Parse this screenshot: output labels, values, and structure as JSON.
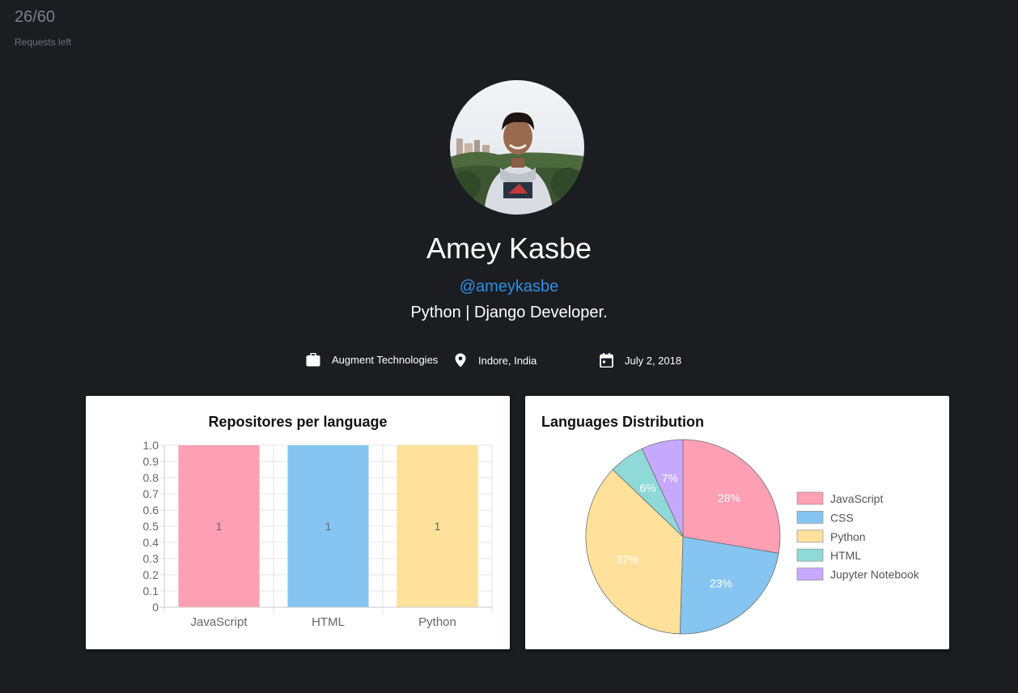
{
  "rate_limit": {
    "count": "26/60",
    "label": "Requests left"
  },
  "profile": {
    "name": "Amey Kasbe",
    "handle": "@ameykasbe",
    "bio": "Python | Django Developer.",
    "company": "Augment Technologies",
    "location": "Indore, India",
    "joined": "July 2, 2018"
  },
  "colors": {
    "background": "#1b1d21",
    "link": "#2e8fe6"
  },
  "chart_data": [
    {
      "type": "bar",
      "title": "Repositores per language",
      "categories": [
        "JavaScript",
        "HTML",
        "Python"
      ],
      "values": [
        1,
        1,
        1
      ],
      "data_labels": [
        "1",
        "1",
        "1"
      ],
      "colors": [
        "#ff9fb3",
        "#86c5f1",
        "#ffe19b"
      ],
      "ylim": [
        0,
        1.0
      ],
      "yticks": [
        "0",
        "0.1",
        "0.2",
        "0.3",
        "0.4",
        "0.5",
        "0.6",
        "0.7",
        "0.8",
        "0.9",
        "1.0"
      ],
      "grid": true
    },
    {
      "type": "pie",
      "title": "Languages Distribution",
      "labels": [
        "JavaScript",
        "CSS",
        "Python",
        "HTML",
        "Jupyter Notebook"
      ],
      "values": [
        28,
        23,
        37,
        6,
        7
      ],
      "data_labels": [
        "28%",
        "23%",
        "37%",
        "6%",
        "7%"
      ],
      "colors": [
        "#ff9fb3",
        "#86c5f1",
        "#ffe19b",
        "#8fd9d8",
        "#c6a9ff"
      ],
      "legend_position": "right"
    }
  ]
}
